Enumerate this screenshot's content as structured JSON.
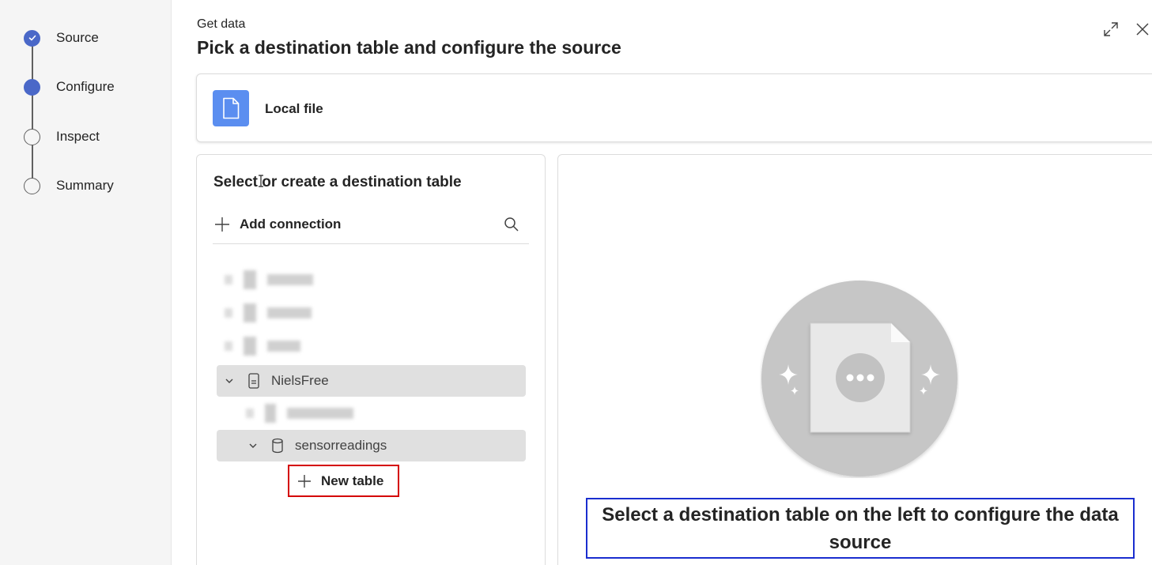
{
  "dialog": {
    "subtitle": "Get data",
    "title": "Pick a destination table and configure the source",
    "expand_icon": "expand-icon",
    "close_icon": "close-icon"
  },
  "stepper": {
    "steps": [
      {
        "label": "Source",
        "state": "done"
      },
      {
        "label": "Configure",
        "state": "active"
      },
      {
        "label": "Inspect",
        "state": "pending"
      },
      {
        "label": "Summary",
        "state": "pending"
      }
    ]
  },
  "source_card": {
    "label": "Local file",
    "icon": "document-icon",
    "icon_color": "#5b8ef0"
  },
  "left_panel": {
    "title": "Select or create a destination table",
    "add_connection_label": "Add connection",
    "tree": {
      "database": "NielsFree",
      "table_group": "sensorreadings",
      "new_table_label": "New table"
    }
  },
  "right_panel": {
    "message": "Select a destination table on the left to configure the data source"
  },
  "colors": {
    "accent": "#4a68c8",
    "highlight_red": "#d40000",
    "highlight_blue": "#1a2ecf",
    "selected_row": "#e0e0e0"
  }
}
